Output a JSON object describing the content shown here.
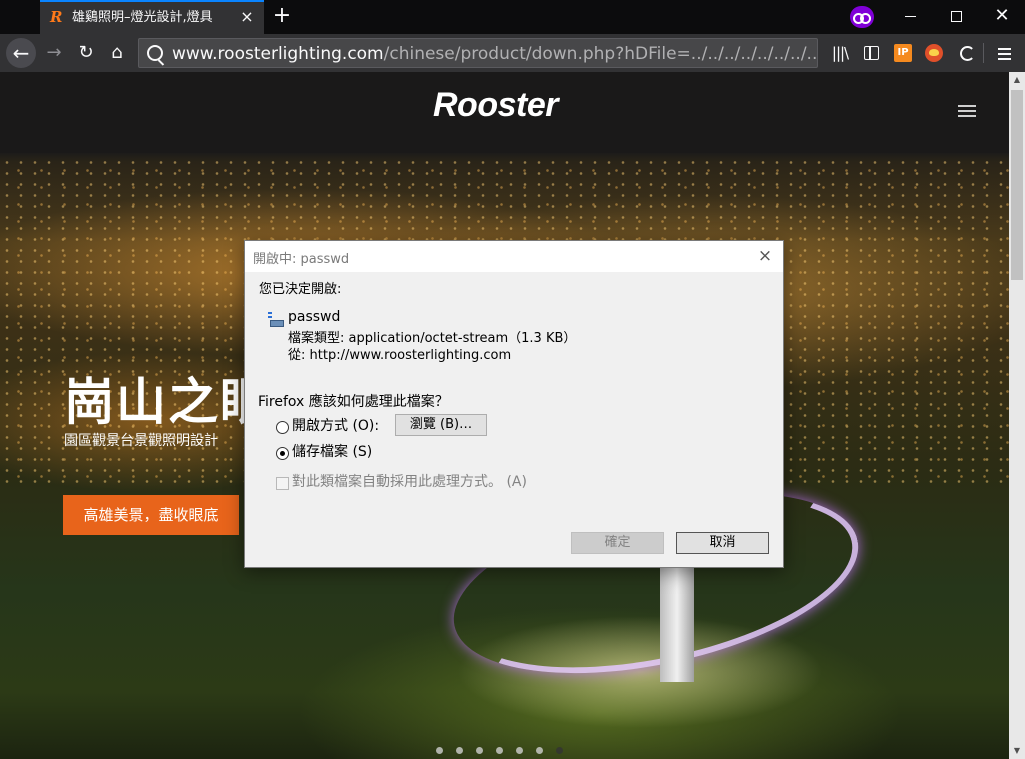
{
  "browser": {
    "tab_title": "雄鷄照明–燈光設計,燈具",
    "tab_favicon": "R",
    "tab_close": "×",
    "new_tab": "+",
    "url_host": "www.roosterlighting.com",
    "url_path": "/chinese/product/down.php?hDFile=../../../../../../../../",
    "icons": [
      "back-arrow-icon",
      "forward-arrow-icon",
      "reload-icon",
      "home-icon",
      "search-icon",
      "library-icon",
      "sidebar-icon",
      "ip-extension-icon",
      "extension-icon",
      "sync-icon",
      "hamburger-menu-icon",
      "private-browsing-icon"
    ],
    "accent": "#0a84ff",
    "private_color": "#8000d7"
  },
  "site": {
    "logo": "Rooster",
    "hero_title": "崗山之眼",
    "hero_subtitle": "園區觀景台景觀照明設計",
    "cta": "高雄美景，盡收眼底",
    "cta_color": "#e8641b",
    "slider_dot_count": 7,
    "slider_active_index": 6
  },
  "dialog": {
    "title": "開啟中: passwd",
    "close": "×",
    "chosen_label": "您已決定開啟:",
    "file_name": "passwd",
    "file_type": "檔案類型: application/octet-stream（1.3 KB）",
    "file_from": "從: http://www.roosterlighting.com",
    "question": "Firefox 應該如何處理此檔案？",
    "open_with_label": "開啟方式 (O):",
    "browse_button": "瀏覽 (B)…",
    "save_file_label": "儲存檔案 (S)",
    "auto_action_label": "對此類檔案自動採用此處理方式。 (A)",
    "ok_button": "確定",
    "cancel_button": "取消",
    "selected_option": "save"
  }
}
